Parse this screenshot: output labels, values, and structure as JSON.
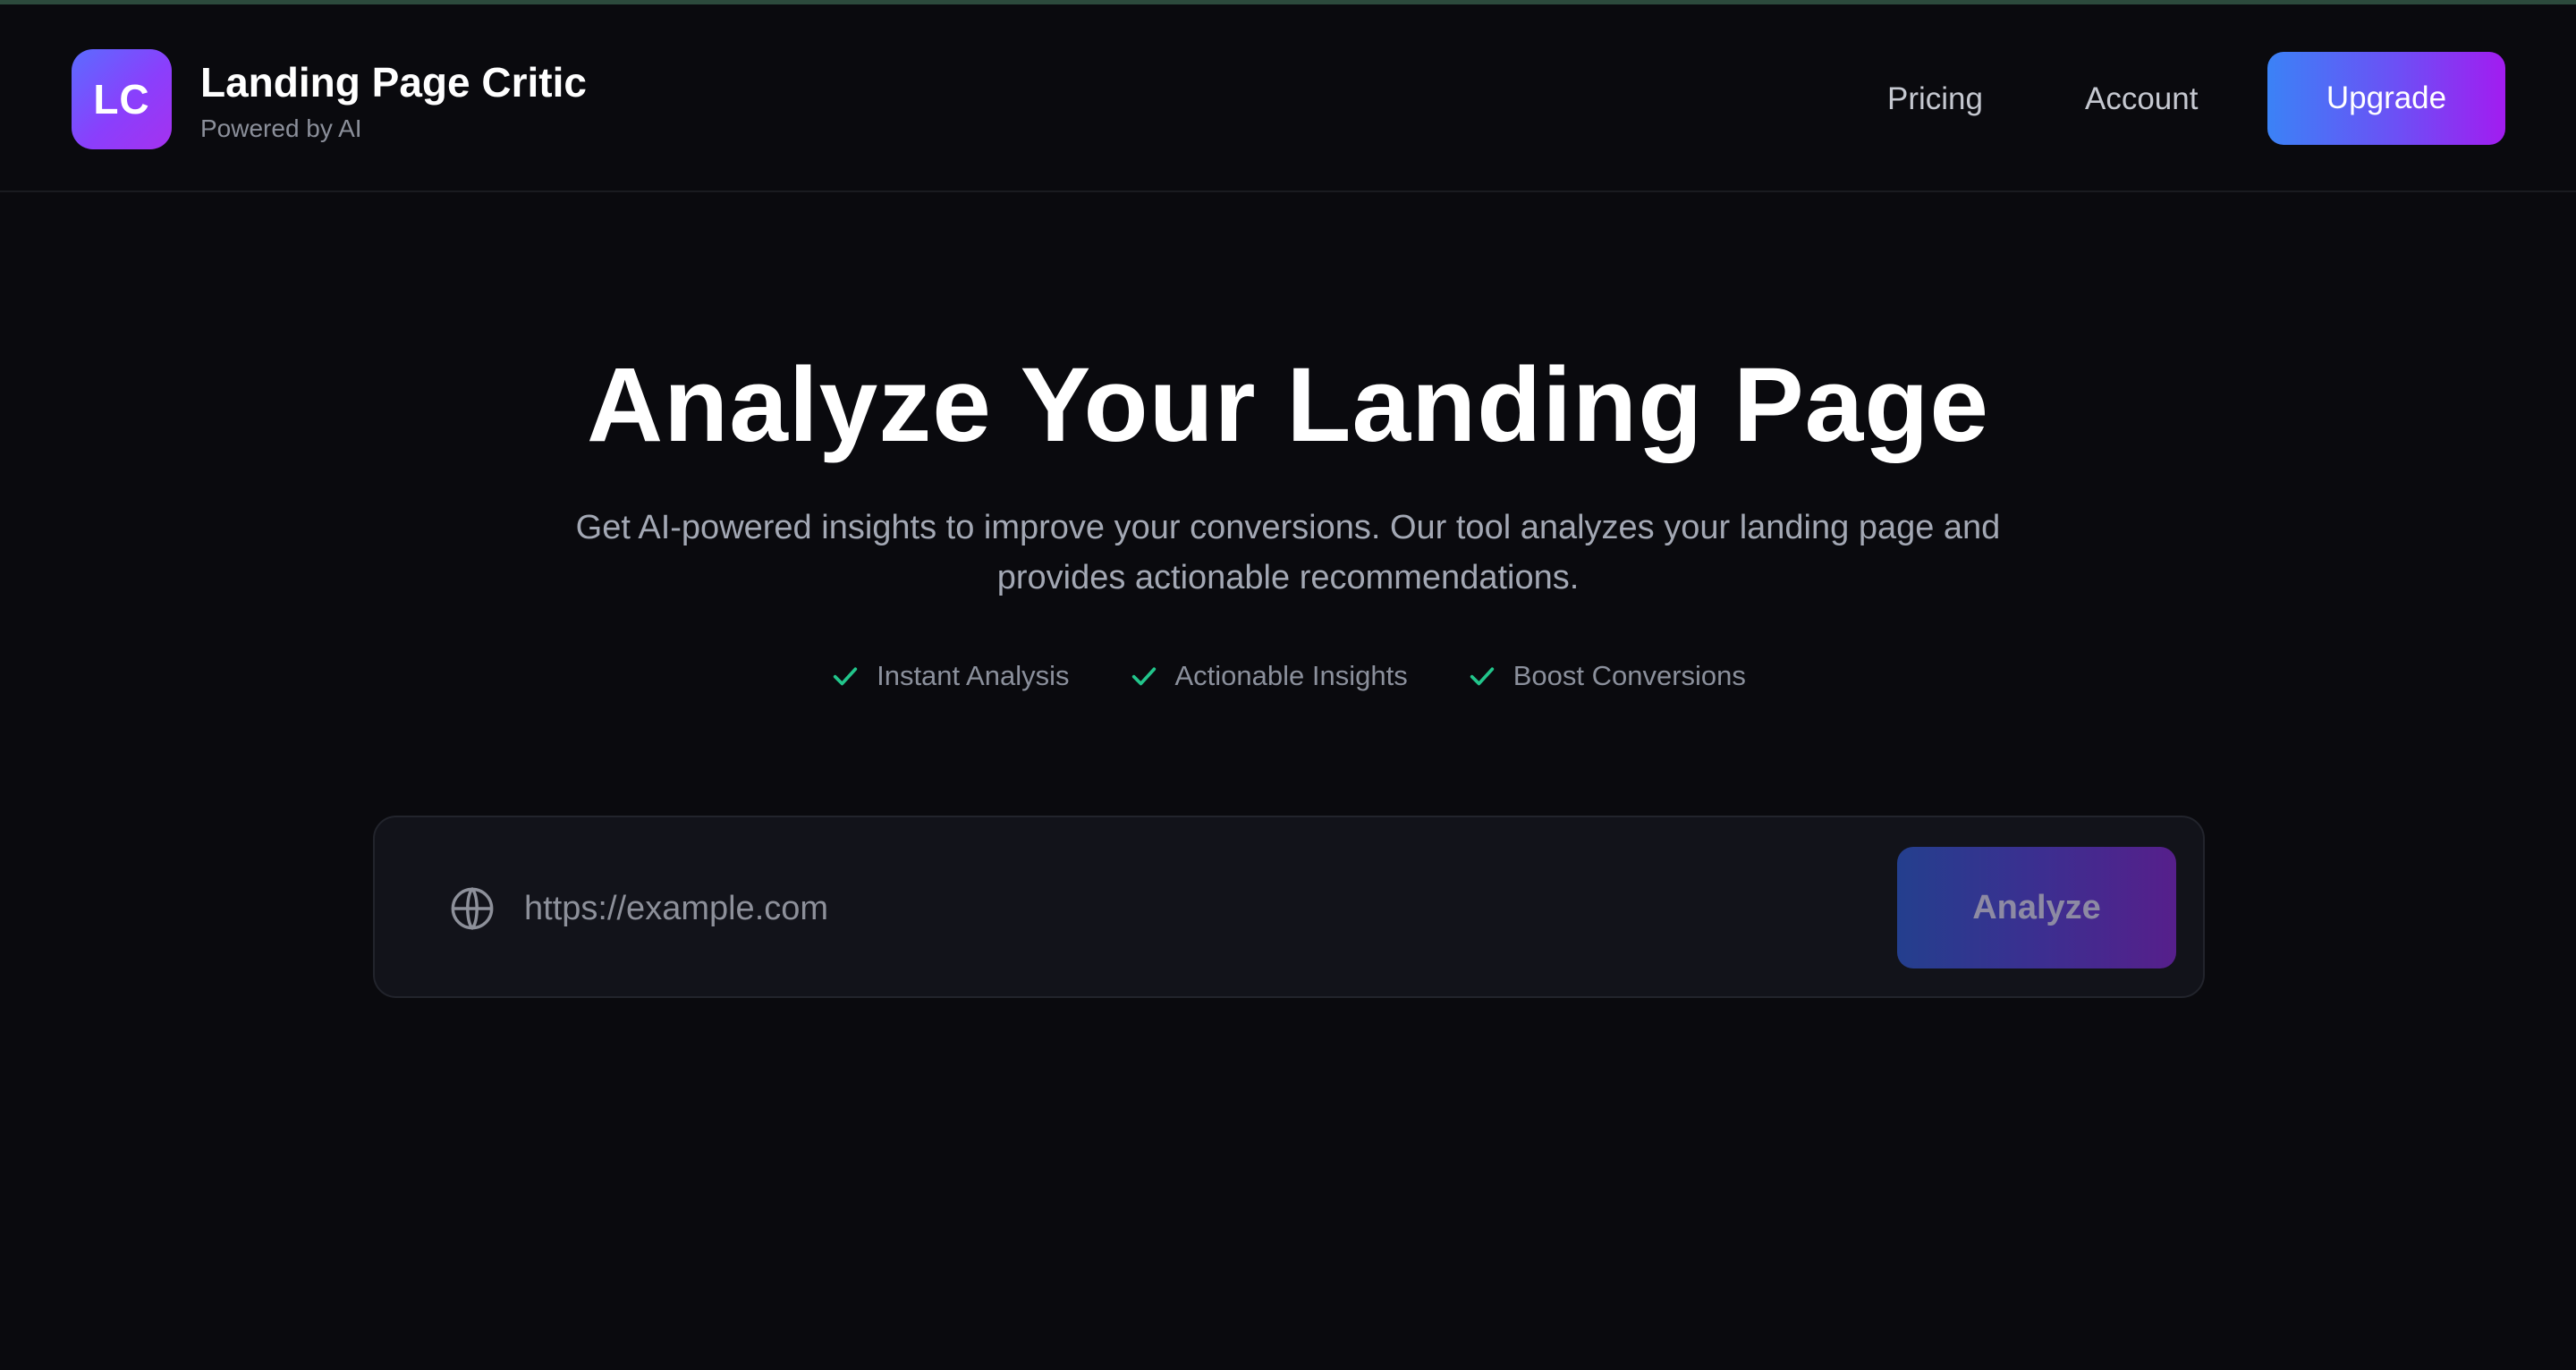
{
  "header": {
    "logo_text": "LC",
    "title": "Landing Page Critic",
    "subtitle": "Powered by AI",
    "nav": {
      "pricing": "Pricing",
      "account": "Account",
      "upgrade": "Upgrade"
    }
  },
  "hero": {
    "title": "Analyze Your Landing Page",
    "description": "Get AI-powered insights to improve your conversions. Our tool analyzes your landing page and provides actionable recommendations.",
    "features": [
      "Instant Analysis",
      "Actionable Insights",
      "Boost Conversions"
    ]
  },
  "search": {
    "icon": "globe-icon",
    "value": "",
    "placeholder": "https://example.com",
    "button_label": "Analyze"
  },
  "colors": {
    "background": "#0a0a0e",
    "accent_blue": "#3b82f6",
    "accent_purple": "#a21cf0",
    "check_green": "#22c58b"
  }
}
